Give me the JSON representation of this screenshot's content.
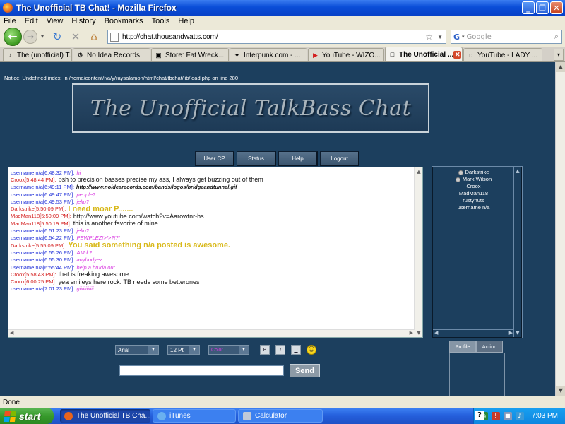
{
  "window": {
    "title": "The Unofficial TB Chat! - Mozilla Firefox"
  },
  "menu": [
    "File",
    "Edit",
    "View",
    "History",
    "Bookmarks",
    "Tools",
    "Help"
  ],
  "nav": {
    "url": "http://chat.thousandwatts.com/",
    "search_placeholder": "Google",
    "search_engine": "G"
  },
  "tabs": [
    {
      "label": "The (unofficial) T...",
      "icon": "♪",
      "active": false
    },
    {
      "label": "No Idea Records",
      "icon": "⚙",
      "active": false
    },
    {
      "label": "Store: Fat Wreck...",
      "icon": "▣",
      "active": false
    },
    {
      "label": "Interpunk.com - ...",
      "icon": "✦",
      "active": false
    },
    {
      "label": "YouTube - WIZO...",
      "icon": "▶",
      "active": false
    },
    {
      "label": "The Unofficial ...",
      "icon": "□",
      "active": true
    },
    {
      "label": "YouTube - LADY ...",
      "icon": "◌",
      "active": false
    }
  ],
  "page": {
    "notice": "Notice: Undefined index: in /home/content/r/a/y/raysalamon/html/chat/tbchat/lib/load.php on line 280",
    "banner_title": "The Unofficial TalkBass Chat",
    "nav_buttons": [
      "User CP",
      "Status",
      "Help",
      "Logout"
    ],
    "messages": [
      {
        "who": "username n/a[6:48:32 PM]:",
        "who_color": "user",
        "text": "hi",
        "color": "#d838e0",
        "size": "small",
        "italic": true,
        "bold": false
      },
      {
        "who": "Croox[5:48:44 PM]:",
        "who_color": "red",
        "text": "psh to precision basses precise my ass, I always get buzzing out of them",
        "color": "#111111",
        "size": "normal",
        "italic": false,
        "bold": false
      },
      {
        "who": "username n/a[6:49:11 PM]:",
        "who_color": "user",
        "text": "http://www.noidearecords.com/bands/logos/bridgeandtunnel.gif",
        "color": "#111111",
        "size": "small",
        "italic": true,
        "bold": true
      },
      {
        "who": "username n/a[6:49:47 PM]:",
        "who_color": "user",
        "text": "people?",
        "color": "#d838e0",
        "size": "small",
        "italic": true,
        "bold": false
      },
      {
        "who": "username n/a[6:49:53 PM]:",
        "who_color": "user",
        "text": "jello?",
        "color": "#d838e0",
        "size": "small",
        "italic": true,
        "bold": false
      },
      {
        "who": "Darkstrike[5:50:09 PM]:",
        "who_color": "red",
        "text": "I need moar P.......",
        "color": "#d8b818",
        "size": "big",
        "italic": false,
        "bold": true
      },
      {
        "who": "MadMan118[5:50:09 PM]:",
        "who_color": "red",
        "text": "http://www.youtube.com/watch?v=Aarowtnr-hs",
        "color": "#111111",
        "size": "normal",
        "italic": false,
        "bold": false
      },
      {
        "who": "MadMan118[5:50:19 PM]:",
        "who_color": "red",
        "text": "this is another favorite of mine",
        "color": "#111111",
        "size": "normal",
        "italic": false,
        "bold": false
      },
      {
        "who": "username n/a[6:51:23 PM]:",
        "who_color": "user",
        "text": "jello?",
        "color": "#d838e0",
        "size": "small",
        "italic": true,
        "bold": false
      },
      {
        "who": "username n/a[6:54:22 PM]:",
        "who_color": "user",
        "text": "PEWPLEZ!>!>?!?!",
        "color": "#d838e0",
        "size": "small",
        "italic": true,
        "bold": false
      },
      {
        "who": "Darkstrike[5:55:09 PM]:",
        "who_color": "red",
        "text": "You said something n/a posted is awesome.",
        "color": "#d8b818",
        "size": "big",
        "italic": false,
        "bold": true
      },
      {
        "who": "username n/a[6:55:26 PM]:",
        "who_color": "user",
        "text": "AMrk?",
        "color": "#d838e0",
        "size": "small",
        "italic": true,
        "bold": false
      },
      {
        "who": "username n/a[6:55:30 PM]:",
        "who_color": "user",
        "text": "anybodyez",
        "color": "#d838e0",
        "size": "small",
        "italic": true,
        "bold": false
      },
      {
        "who": "username n/a[6:55:44 PM]:",
        "who_color": "user",
        "text": "help a bruda out",
        "color": "#d838e0",
        "size": "small",
        "italic": true,
        "bold": false
      },
      {
        "who": "Croox[5:58:43 PM]:",
        "who_color": "red",
        "text": "that is freaking awesome.",
        "color": "#111111",
        "size": "normal",
        "italic": false,
        "bold": false
      },
      {
        "who": "Croox[6:00:25 PM]:",
        "who_color": "red",
        "text": "yea smileys here rock. TB needs some betterones",
        "color": "#111111",
        "size": "normal",
        "italic": false,
        "bold": false
      },
      {
        "who": "username n/a[7:01:23 PM]:",
        "who_color": "user",
        "text": "giiiiiiiiiiii",
        "color": "#d838e0",
        "size": "small",
        "italic": true,
        "bold": false
      }
    ],
    "users": [
      {
        "name": "Darkstrike",
        "avatar": true
      },
      {
        "name": "Mark Wilson",
        "avatar": true
      },
      {
        "name": "Croox",
        "avatar": false
      },
      {
        "name": "MadMan118",
        "avatar": false
      },
      {
        "name": "rustynuts",
        "avatar": false
      },
      {
        "name": "username n/a",
        "avatar": false
      }
    ],
    "format": {
      "font": "Arial",
      "size": "12 Pt",
      "color_label": "Color",
      "bold": "B",
      "italic": "I",
      "underline": "U"
    },
    "send_label": "Send",
    "panel_tabs": [
      "Profile",
      "Action"
    ]
  },
  "status": "Done",
  "taskbar": {
    "start": "start",
    "items": [
      {
        "label": "The Unofficial TB Cha...",
        "active": true,
        "icon_color": "#e8641b"
      },
      {
        "label": "iTunes",
        "active": false,
        "icon_color": "#6ab0f0"
      },
      {
        "label": "Calculator",
        "active": false,
        "icon_color": "#c0c8d8"
      }
    ],
    "clock": "7:03 PM"
  }
}
